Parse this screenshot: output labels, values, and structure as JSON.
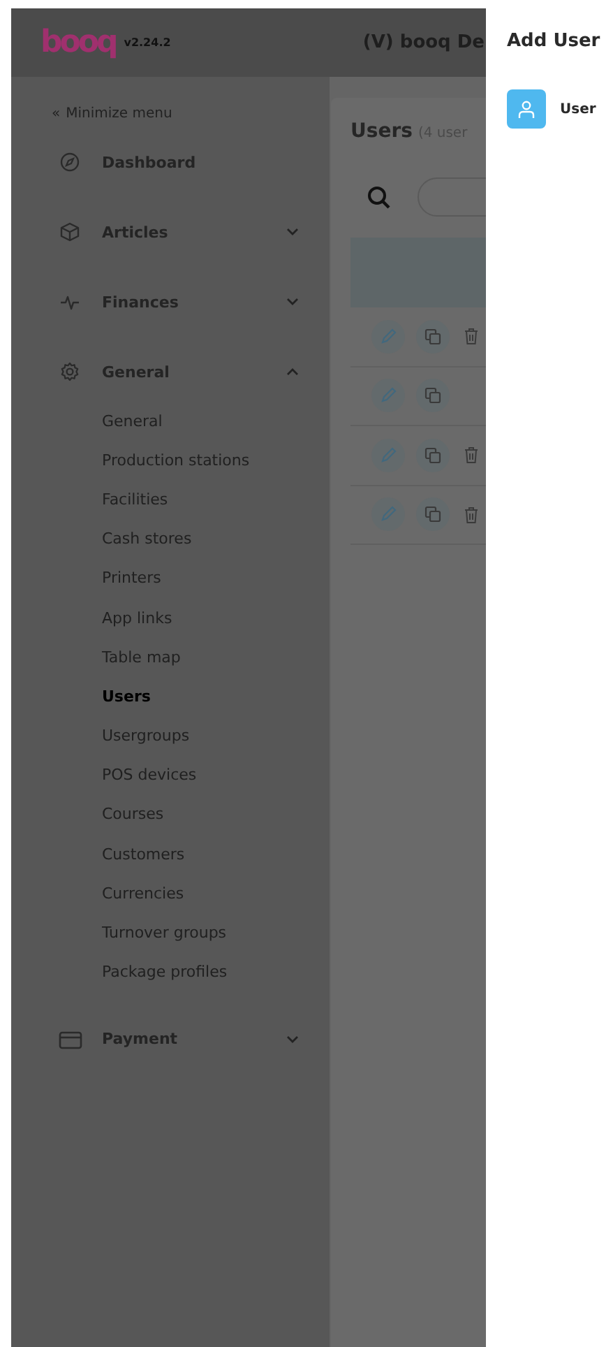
{
  "header": {
    "logo": "booq",
    "version": "v2.24.2",
    "title": "(V) booq De"
  },
  "sidebar": {
    "minimize": {
      "icon": "«",
      "label": "Minimize menu"
    },
    "items": [
      {
        "kind": "dashboard",
        "label": "Dashboard"
      },
      {
        "kind": "articles",
        "label": "Articles",
        "expanded": false
      },
      {
        "kind": "finances",
        "label": "Finances",
        "expanded": false
      },
      {
        "kind": "general",
        "label": "General",
        "expanded": true,
        "children": [
          {
            "label": "General",
            "selected": false
          },
          {
            "label": "Production stations",
            "selected": false
          },
          {
            "label": "Facilities",
            "selected": false
          },
          {
            "label": "Cash stores",
            "selected": false
          },
          {
            "label": "Printers",
            "selected": false
          },
          {
            "label": "App links",
            "selected": false
          },
          {
            "label": "Table map",
            "selected": false
          },
          {
            "label": "Users",
            "selected": true
          },
          {
            "label": "Usergroups",
            "selected": false
          },
          {
            "label": "POS devices",
            "selected": false
          },
          {
            "label": "Courses",
            "selected": false
          },
          {
            "label": "Customers",
            "selected": false
          },
          {
            "label": "Currencies",
            "selected": false
          },
          {
            "label": "Turnover groups",
            "selected": false
          },
          {
            "label": "Package profiles",
            "selected": false
          }
        ]
      },
      {
        "kind": "payment",
        "label": "Payment",
        "expanded": false
      }
    ]
  },
  "users": {
    "title": "Users",
    "count": "(4 user",
    "rows": [
      {
        "deletable": true
      },
      {
        "deletable": false
      },
      {
        "deletable": true
      },
      {
        "deletable": true
      }
    ]
  },
  "panel": {
    "title": "Add User",
    "options": [
      {
        "label": "User"
      }
    ]
  }
}
